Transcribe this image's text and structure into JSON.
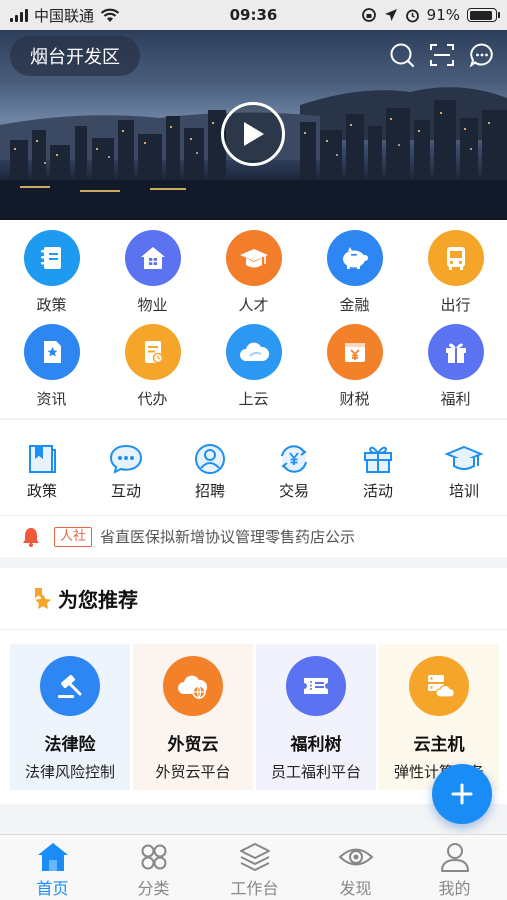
{
  "status_bar": {
    "carrier": "中国联通",
    "time": "09:36",
    "battery": "91%",
    "battery_level": 0.91
  },
  "hero": {
    "location": "烟台开发区",
    "icons": [
      "search-icon",
      "scan-icon",
      "message-icon",
      "play-icon"
    ]
  },
  "services": [
    {
      "label": "政策",
      "icon": "notebook-icon",
      "color": "#1e9bf0"
    },
    {
      "label": "物业",
      "icon": "house-icon",
      "color": "#5b73f0"
    },
    {
      "label": "人才",
      "icon": "graduation-cap-icon",
      "color": "#f27d2a"
    },
    {
      "label": "金融",
      "icon": "piggy-bank-icon",
      "color": "#2d86f2"
    },
    {
      "label": "出行",
      "icon": "bus-icon",
      "color": "#f6a52b"
    },
    {
      "label": "资讯",
      "icon": "news-icon",
      "color": "#2d86f2"
    },
    {
      "label": "代办",
      "icon": "document-icon",
      "color": "#f6a52b"
    },
    {
      "label": "上云",
      "icon": "cloud-icon",
      "color": "#2d98f2"
    },
    {
      "label": "财税",
      "icon": "yen-box-icon",
      "color": "#f2812a"
    },
    {
      "label": "福利",
      "icon": "gift-icon",
      "color": "#5b73f0"
    }
  ],
  "categories": [
    {
      "label": "政策",
      "icon": "book-icon"
    },
    {
      "label": "互动",
      "icon": "chat-icon"
    },
    {
      "label": "招聘",
      "icon": "person-icon"
    },
    {
      "label": "交易",
      "icon": "yen-exchange-icon"
    },
    {
      "label": "活动",
      "icon": "gift-box-icon"
    },
    {
      "label": "培训",
      "icon": "mortarboard-icon"
    }
  ],
  "notice": {
    "tag": "人社",
    "text": "省直医保拟新增协议管理零售药店公示"
  },
  "recommend": {
    "title": "为您推荐",
    "cards": [
      {
        "name": "法律险",
        "desc": "法律风险控制",
        "icon": "gavel-icon",
        "color": "#2d86f2",
        "bg": "#eef4fc"
      },
      {
        "name": "外贸云",
        "desc": "外贸云平台",
        "icon": "globe-cloud-icon",
        "color": "#f2812a",
        "bg": "#fcf5ef"
      },
      {
        "name": "福利树",
        "desc": "员工福利平台",
        "icon": "ticket-icon",
        "color": "#5b73f0",
        "bg": "#f1f2fc"
      },
      {
        "name": "云主机",
        "desc": "弹性计算服务",
        "icon": "server-cloud-icon",
        "color": "#f6a52b",
        "bg": "#fcf8ec"
      }
    ]
  },
  "tabbar": [
    {
      "label": "首页",
      "icon": "home-icon",
      "active": true
    },
    {
      "label": "分类",
      "icon": "category-icon",
      "active": false
    },
    {
      "label": "工作台",
      "icon": "layers-icon",
      "active": false
    },
    {
      "label": "发现",
      "icon": "eye-icon",
      "active": false
    },
    {
      "label": "我的",
      "icon": "user-icon",
      "active": false
    }
  ],
  "colors": {
    "accent": "#1a8cf5",
    "notice_tag": "#e8634a",
    "bell": "#f05a3c"
  }
}
